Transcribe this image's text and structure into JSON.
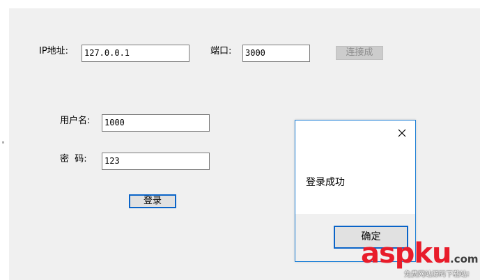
{
  "server": {
    "ip_label": "IP地址:",
    "ip_value": "127.0.0.1",
    "port_label": "端口:",
    "port_value": "3000",
    "connect_button": "连接成"
  },
  "login": {
    "username_label": "用户名:",
    "username_value": "1000",
    "password_label": "密  码:",
    "password_value": "123",
    "login_button": "登录"
  },
  "dialog": {
    "message": "登录成功",
    "ok_button": "确定",
    "close_icon": "close-icon"
  },
  "watermark": {
    "brand": "aspku",
    "tld": ".com",
    "tagline": "免费网站源码下载站!"
  }
}
